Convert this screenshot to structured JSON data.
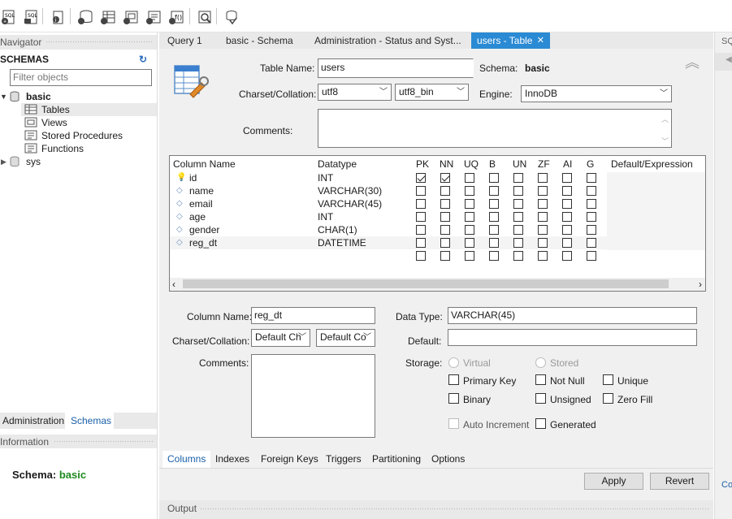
{
  "navigator": {
    "title": "Navigator",
    "schemas_label": "SCHEMAS",
    "filter_placeholder": "Filter objects",
    "tree": [
      {
        "label": "basic",
        "bold": true
      },
      {
        "label": "Tables"
      },
      {
        "label": "Views"
      },
      {
        "label": "Stored Procedures"
      },
      {
        "label": "Functions"
      },
      {
        "label": "sys"
      }
    ],
    "bottom_tabs": [
      "Administration",
      "Schemas"
    ],
    "information_title": "Information",
    "schema_label": "Schema:",
    "schema_value": "basic"
  },
  "tabs": [
    "Query 1",
    "basic - Schema",
    "Administration - Status and Syst...",
    "users - Table"
  ],
  "table_form": {
    "table_name_label": "Table Name:",
    "table_name": "users",
    "schema_label": "Schema:",
    "schema": "basic",
    "charset_label": "Charset/Collation:",
    "charset": "utf8",
    "collation": "utf8_bin",
    "engine_label": "Engine:",
    "engine": "InnoDB",
    "comments_label": "Comments:"
  },
  "grid": {
    "headers": [
      "Column Name",
      "Datatype",
      "PK",
      "NN",
      "UQ",
      "B",
      "UN",
      "ZF",
      "AI",
      "G",
      "Default/Expression"
    ],
    "rows": [
      {
        "name": "id",
        "type": "INT",
        "key": true,
        "pk": true,
        "nn": true
      },
      {
        "name": "name",
        "type": "VARCHAR(30)",
        "key": false,
        "pk": false,
        "nn": false
      },
      {
        "name": "email",
        "type": "VARCHAR(45)",
        "key": false,
        "pk": false,
        "nn": false
      },
      {
        "name": "age",
        "type": "INT",
        "key": false,
        "pk": false,
        "nn": false
      },
      {
        "name": "gender",
        "type": "CHAR(1)",
        "key": false,
        "pk": false,
        "nn": false
      },
      {
        "name": "reg_dt",
        "type": "DATETIME",
        "key": false,
        "pk": false,
        "nn": false
      }
    ]
  },
  "column_detail": {
    "column_name_label": "Column Name:",
    "column_name": "reg_dt",
    "charset_label": "Charset/Collation:",
    "charset": "Default Ch",
    "collation": "Default Co",
    "comments_label": "Comments:",
    "data_type_label": "Data Type:",
    "data_type": "VARCHAR(45)",
    "default_label": "Default:",
    "storage_label": "Storage:",
    "virtual": "Virtual",
    "stored": "Stored",
    "primary_key": "Primary Key",
    "not_null": "Not Null",
    "unique": "Unique",
    "binary": "Binary",
    "unsigned": "Unsigned",
    "zero_fill": "Zero Fill",
    "auto_increment": "Auto Increment",
    "generated": "Generated"
  },
  "sub_tabs": [
    "Columns",
    "Indexes",
    "Foreign Keys",
    "Triggers",
    "Partitioning",
    "Options"
  ],
  "buttons": {
    "apply": "Apply",
    "revert": "Revert"
  },
  "output_title": "Output",
  "right_pane": {
    "title": "SQ",
    "bottom": "Co"
  },
  "colors": {
    "accent": "#0078d7",
    "active_tab": "#2a8ad4",
    "link_tab": "#1a5fa8",
    "schema_value": "#1e8a1e"
  }
}
